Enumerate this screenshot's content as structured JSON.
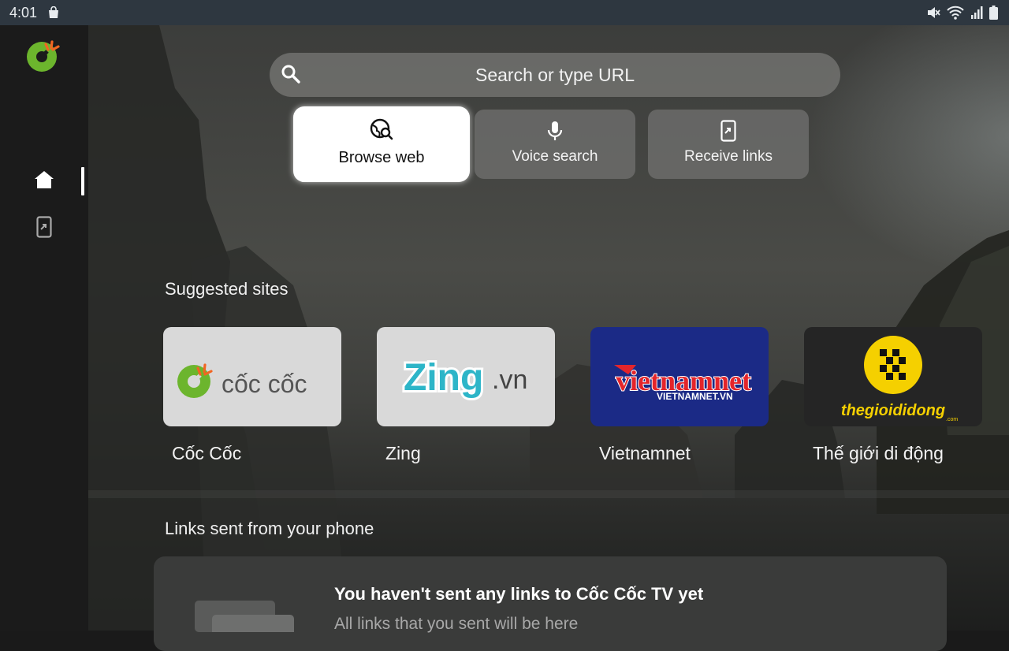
{
  "status_bar": {
    "time": "4:01"
  },
  "search": {
    "placeholder": "Search or type URL"
  },
  "actions": [
    {
      "label": "Browse web",
      "icon": "globe-search-icon",
      "selected": true
    },
    {
      "label": "Voice search",
      "icon": "mic-icon"
    },
    {
      "label": "Receive links",
      "icon": "phone-link-icon"
    }
  ],
  "suggested": {
    "title": "Suggested sites",
    "sites": [
      {
        "name": "Cốc Cốc",
        "logo_text": "cốc cốc",
        "bg": "#d9d9d9"
      },
      {
        "name": "Zing",
        "logo_text": "Zing",
        "logo_suffix": ".vn",
        "bg": "#d9d9d9"
      },
      {
        "name": "Vietnamnet",
        "logo_text": "vietnamnet",
        "logo_sub": "VIETNAMNET.VN",
        "bg": "#1b2a86"
      },
      {
        "name": "Thế giới di động",
        "logo_text": "thegioididong",
        "logo_sub": ".com",
        "bg": "#252525"
      }
    ]
  },
  "links": {
    "title": "Links sent from your phone",
    "empty_title": "You haven't sent any links to Cốc Cốc TV yet",
    "empty_subtitle": "All links that you sent will be here"
  },
  "colors": {
    "accent_green": "#6cb52d",
    "accent_orange": "#f26522",
    "vietnamnet_red": "#e4252b",
    "tgdd_yellow": "#f5d000"
  }
}
